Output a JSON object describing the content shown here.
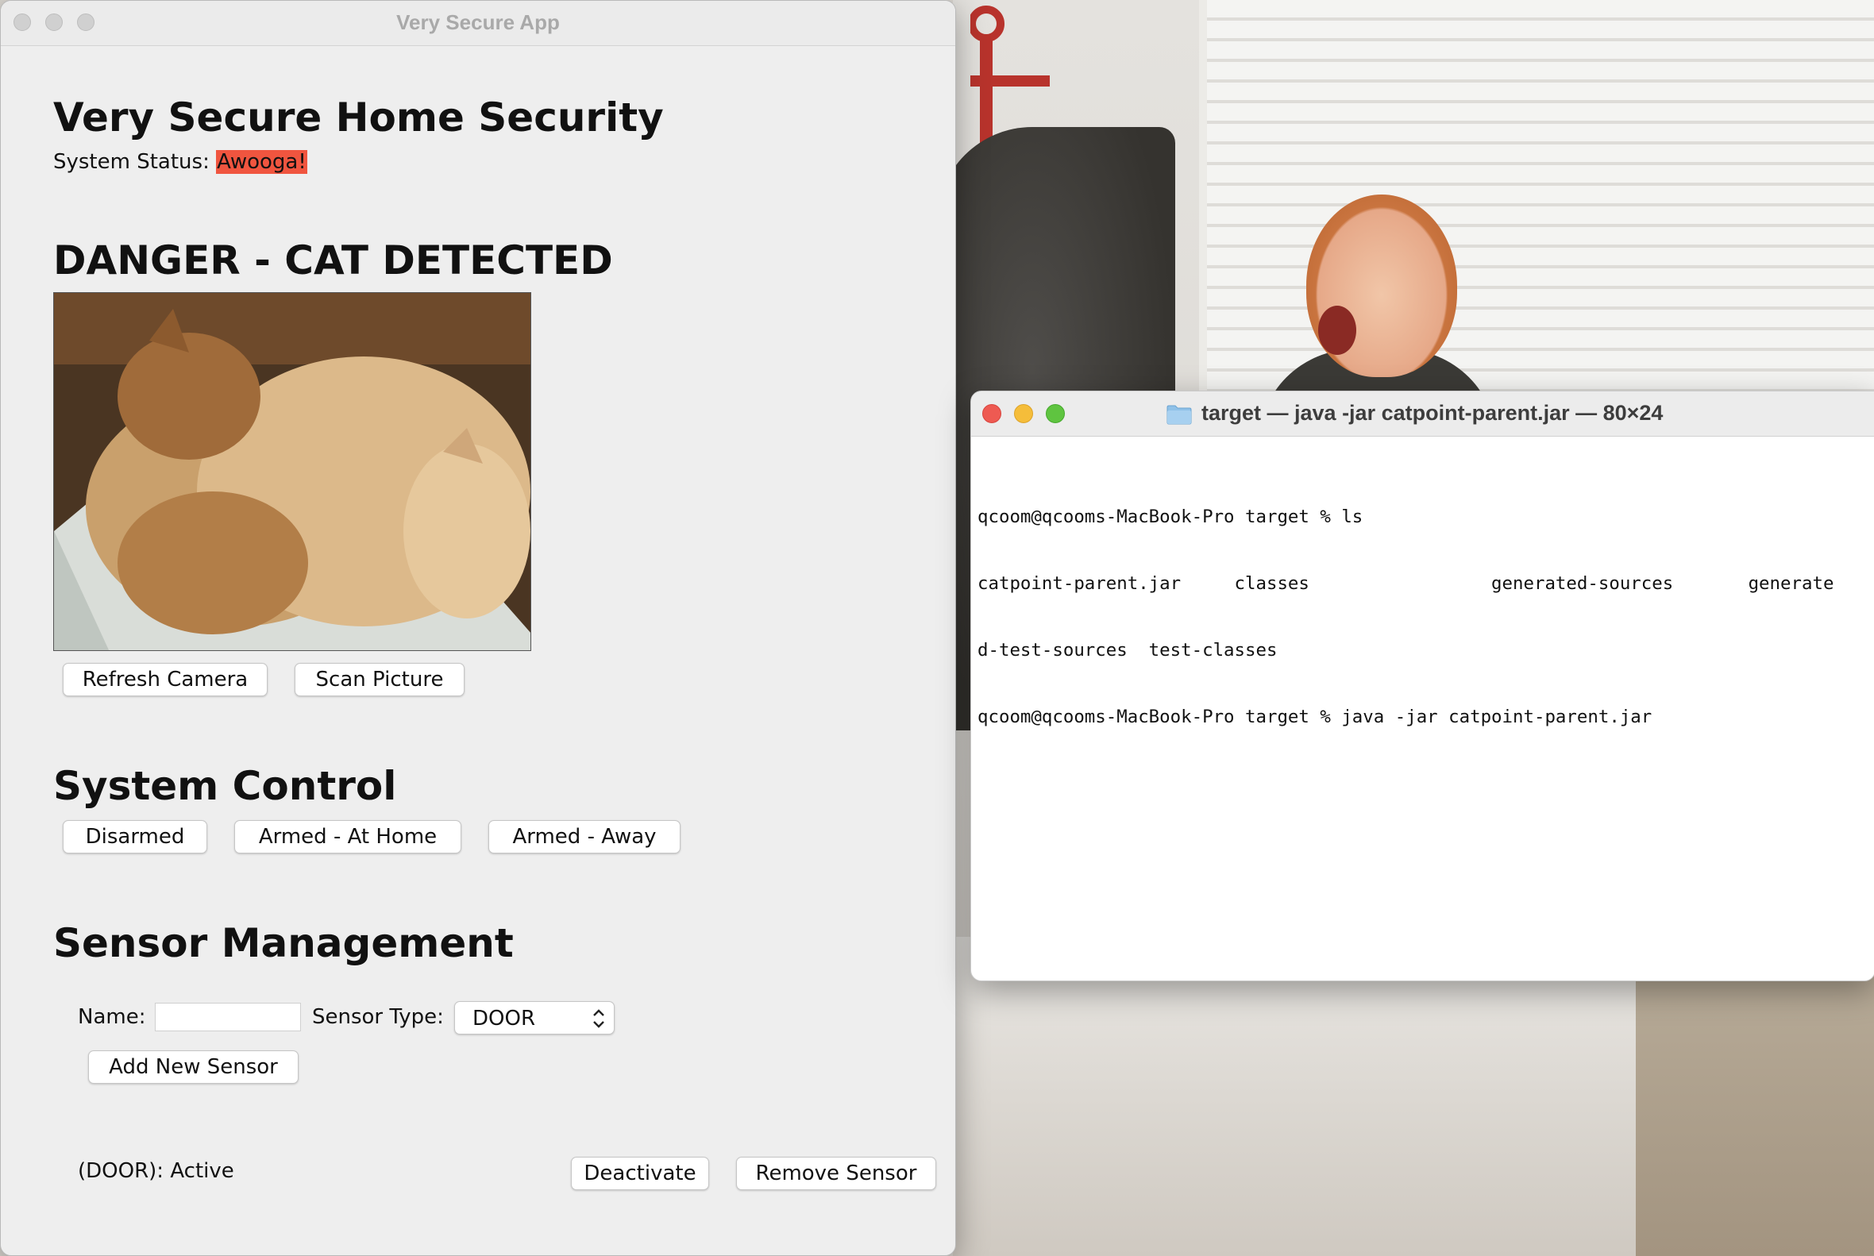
{
  "app": {
    "window_title": "Very Secure App",
    "heading": "Very Secure Home Security",
    "status_label": "System Status:",
    "status_value": "Awooga!",
    "status_color": "#f0553f",
    "alert_heading": "DANGER - CAT DETECTED",
    "camera": {
      "refresh_label": "Refresh Camera",
      "scan_label": "Scan Picture"
    },
    "system_control": {
      "heading": "System Control",
      "modes": [
        "Disarmed",
        "Armed - At Home",
        "Armed - Away"
      ]
    },
    "sensor_management": {
      "heading": "Sensor Management",
      "name_label": "Name:",
      "name_value": "",
      "type_label": "Sensor Type:",
      "type_value": "DOOR",
      "add_label": "Add New Sensor",
      "sensors": [
        {
          "label": "(DOOR): Active",
          "deactivate_label": "Deactivate",
          "remove_label": "Remove Sensor"
        }
      ]
    }
  },
  "terminal": {
    "title": "target — java -jar catpoint-parent.jar — 80×24",
    "lines": [
      "qcoom@qcooms-MacBook-Pro target % ls",
      "catpoint-parent.jar     classes                 generated-sources       generate",
      "d-test-sources  test-classes",
      "qcoom@qcooms-MacBook-Pro target % java -jar catpoint-parent.jar"
    ]
  }
}
